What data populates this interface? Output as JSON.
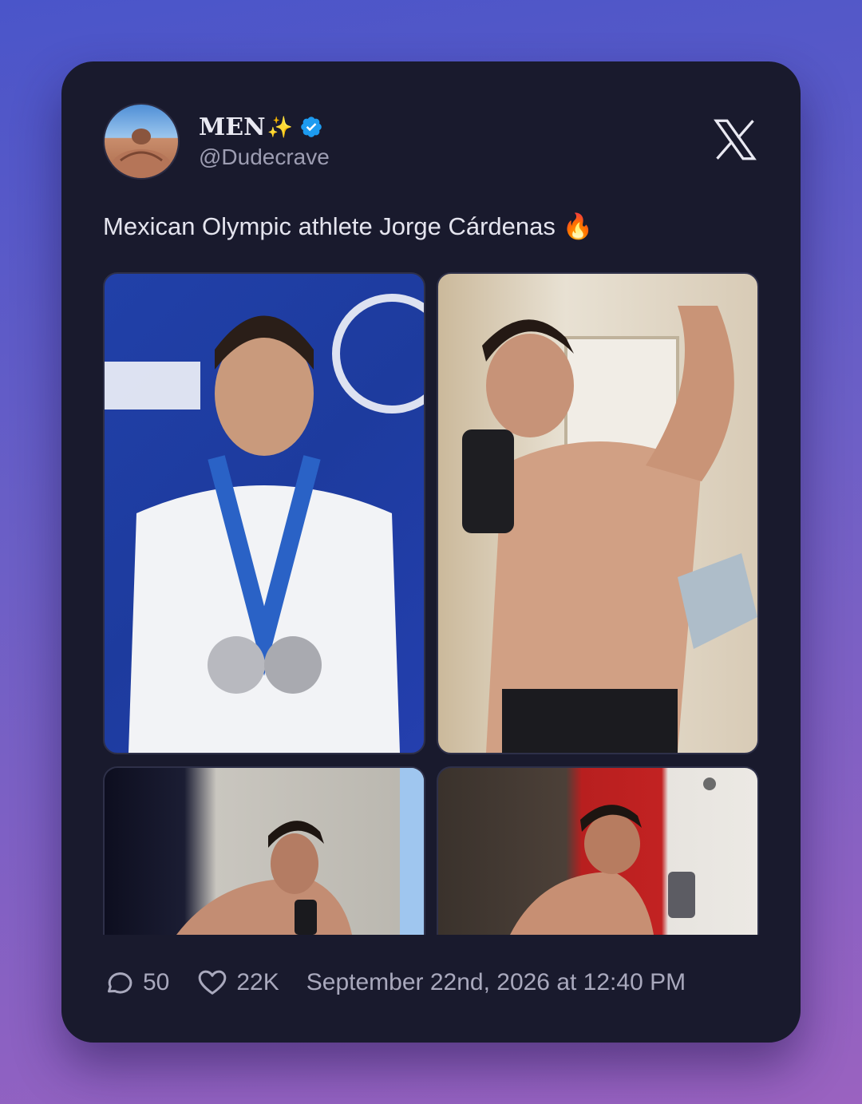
{
  "post": {
    "display_name": "MEN",
    "name_emoji": "✨",
    "handle": "@Dudecrave",
    "verified": true,
    "text": "Mexican Olympic athlete Jorge Cárdenas 🔥",
    "platform_icon": "x-logo-icon",
    "images": [
      {
        "name": "photo-1"
      },
      {
        "name": "photo-2"
      },
      {
        "name": "photo-3"
      },
      {
        "name": "photo-4"
      }
    ]
  },
  "stats": {
    "replies": "50",
    "likes": "22K",
    "timestamp": "September 22nd, 2026 at 12:40 PM"
  },
  "colors": {
    "card_bg": "#191a2d",
    "verified_badge": "#1d9bf0",
    "text_primary": "#e4e4ee",
    "text_secondary": "#9d9db2"
  }
}
